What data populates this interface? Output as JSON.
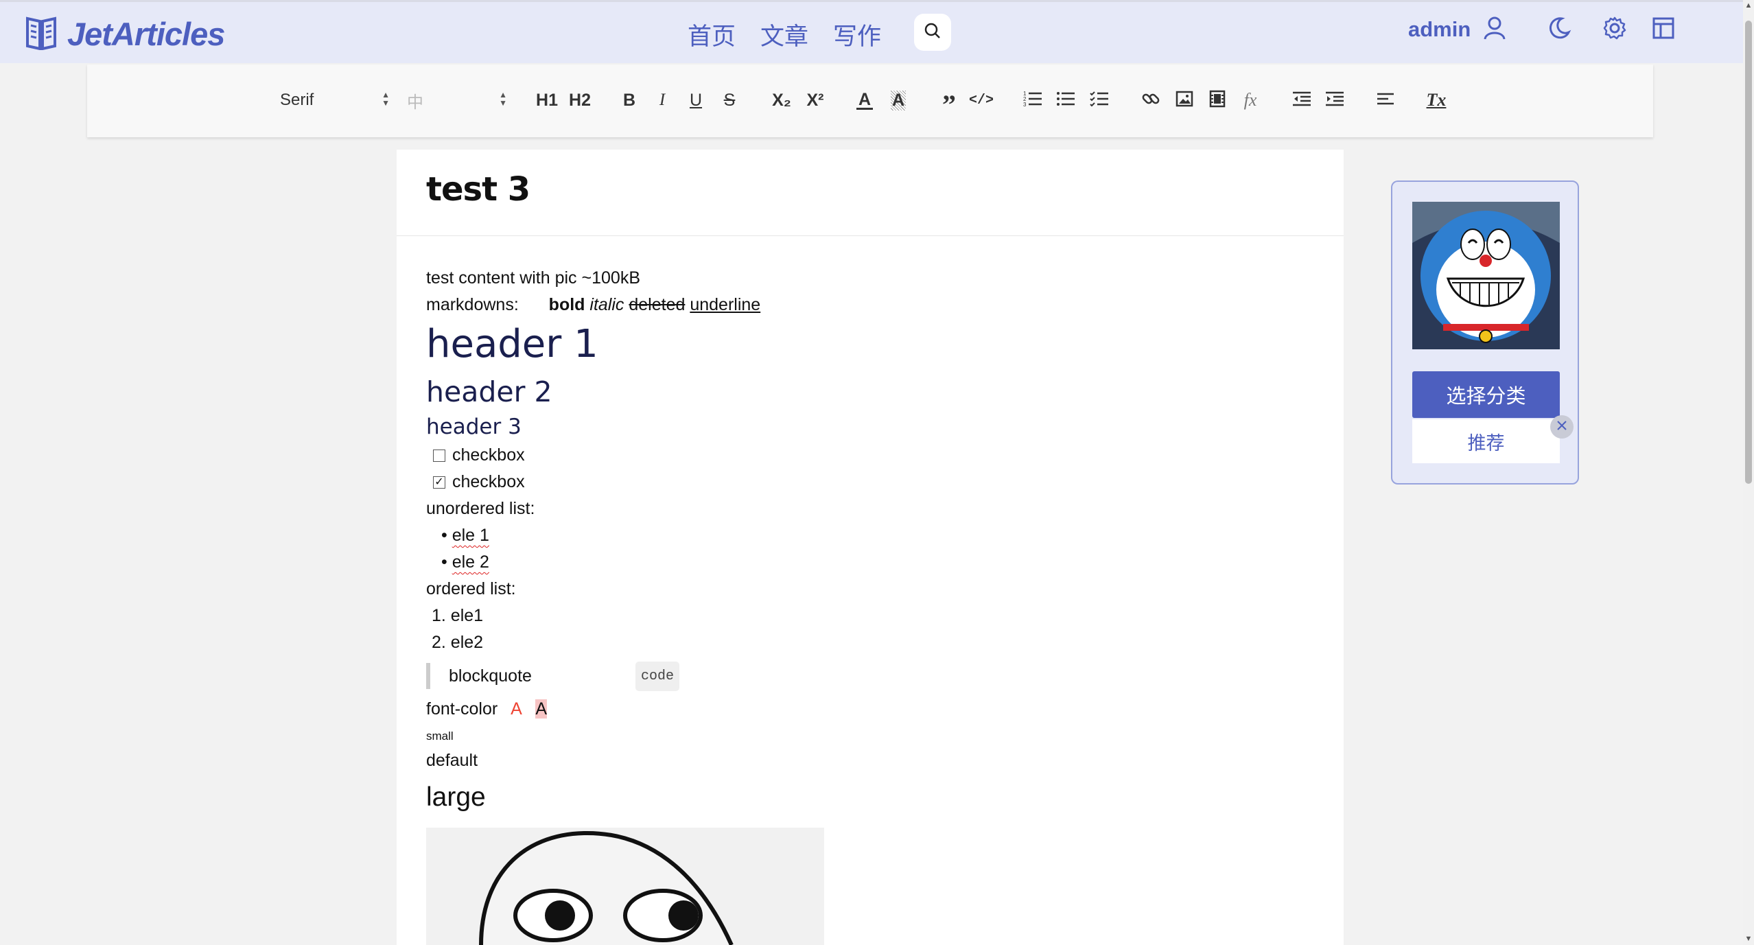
{
  "app": {
    "name": "JetArticles"
  },
  "nav": {
    "items": [
      "首页",
      "文章",
      "写作"
    ]
  },
  "user": {
    "name": "admin"
  },
  "toolbar": {
    "font_family": "Serif",
    "font_size": "中",
    "h1": "H1",
    "h2": "H2",
    "bold": "B",
    "italic": "I",
    "underline": "U",
    "strike": "S",
    "sub": "X₂",
    "sup": "X²",
    "color": "A",
    "bg": "A",
    "formula": "fx",
    "clean": "Tx"
  },
  "article": {
    "title": "test 3",
    "line1": "test content with pic ~100kB",
    "markdowns_label": "markdowns:",
    "bold": "bold",
    "italic": "italic",
    "deleted": "deleted",
    "underline": "underline",
    "h1": "header 1",
    "h2": "header 2",
    "h3": "header 3",
    "checkbox1": "checkbox",
    "checkbox2": "checkbox",
    "unordered_label": "unordered list:",
    "ul_items": [
      "ele 1",
      "ele 2"
    ],
    "ordered_label": "ordered list:",
    "ol_items": [
      "1. ele1",
      "2. ele2"
    ],
    "blockquote": "blockquote",
    "code": "code",
    "font_color_label": "font-color",
    "font_color_a": "A",
    "font_bg_a": "A",
    "small": "small",
    "default": "default",
    "large": "large"
  },
  "side": {
    "category_button": "选择分类",
    "tag": "推荐"
  },
  "colors": {
    "accent": "#4d5fbf",
    "topbar_bg": "#e6e9f8",
    "heading": "#1a1f4e"
  }
}
